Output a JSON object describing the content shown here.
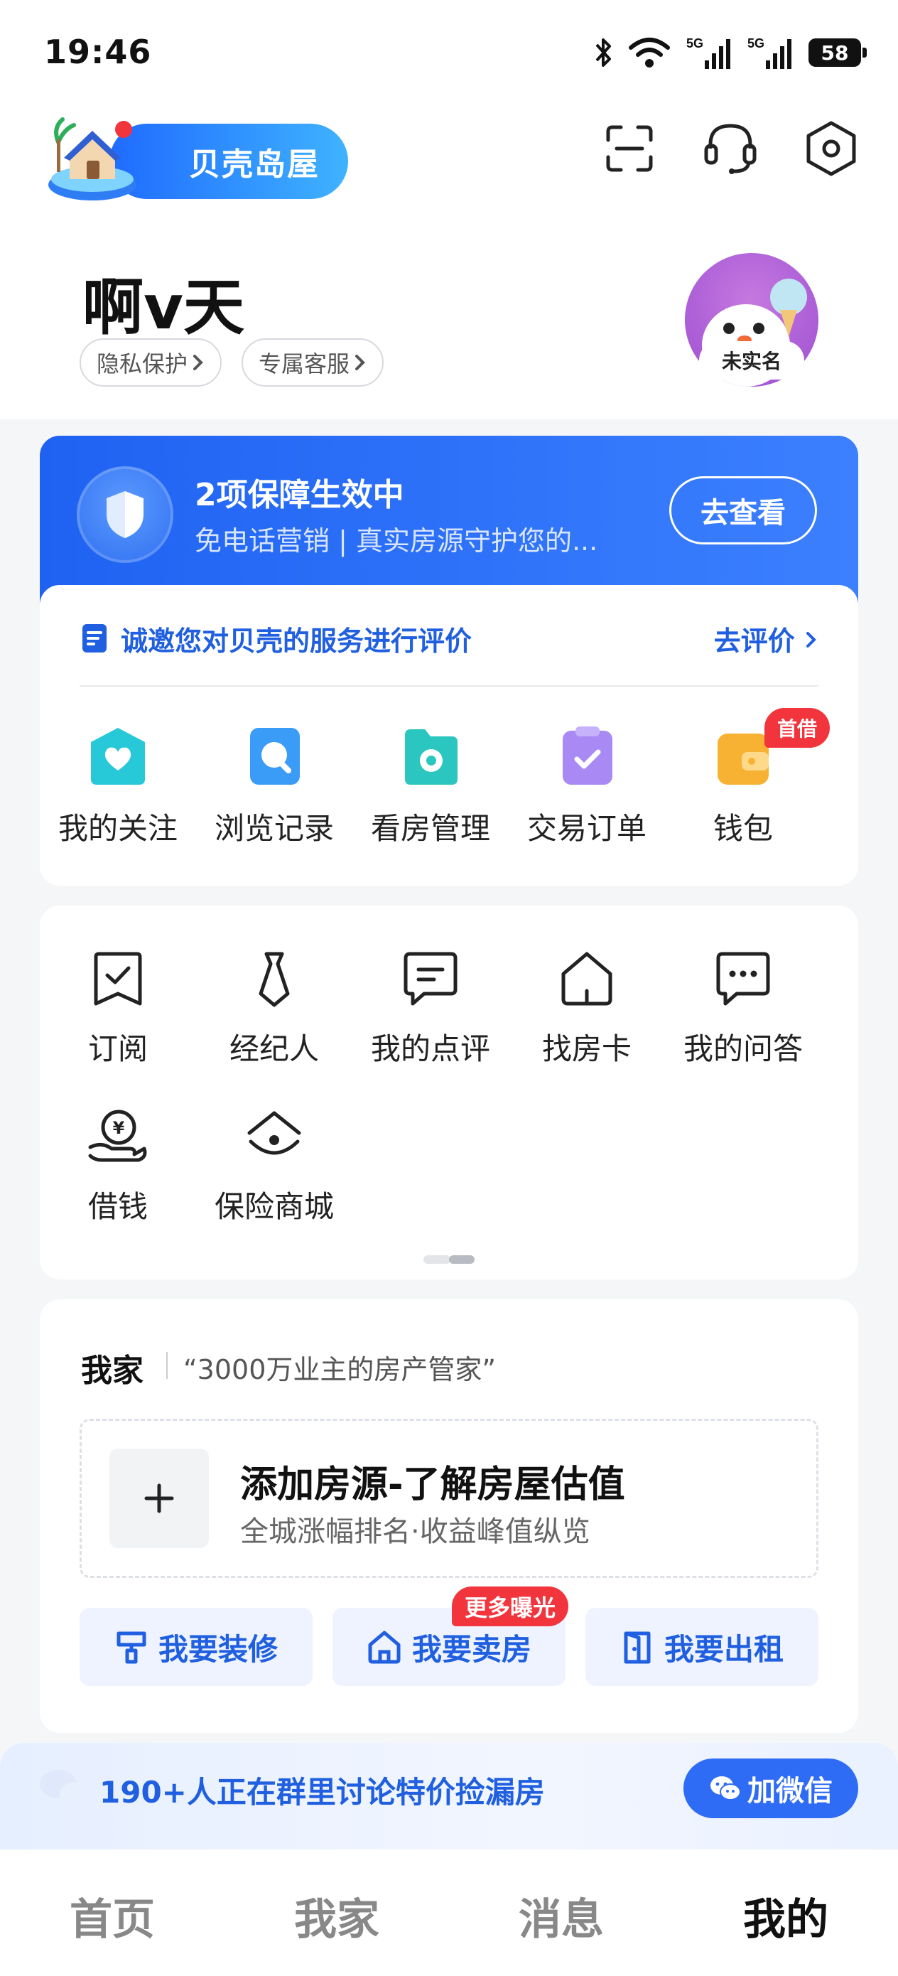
{
  "status_bar": {
    "time": "19:46",
    "battery": "58"
  },
  "app": {
    "logo_text": "贝壳岛屋"
  },
  "profile": {
    "name": "啊v天",
    "chips": [
      "隐私保护",
      "专属客服"
    ],
    "avatar_badge": "未实名"
  },
  "protection": {
    "title": "2项保障生效中",
    "subtitle": "免电话营销 | 真实房源守护您的...",
    "button": "去查看"
  },
  "review": {
    "text": "诚邀您对贝壳的服务进行评价",
    "link": "去评价"
  },
  "quick_services": [
    {
      "label": "我的关注",
      "icon": "heart-icon",
      "color": "#27c8d8"
    },
    {
      "label": "浏览记录",
      "icon": "search-icon",
      "color": "#3a9cf6"
    },
    {
      "label": "看房管理",
      "icon": "folder-icon",
      "color": "#2cc6c0"
    },
    {
      "label": "交易订单",
      "icon": "clipboard-icon",
      "color": "#a98af5"
    },
    {
      "label": "钱包",
      "icon": "wallet-icon",
      "color": "#f7b233"
    }
  ],
  "wallet_badge": "首借",
  "tools": [
    {
      "label": "订阅",
      "icon": "subscribe-icon"
    },
    {
      "label": "经纪人",
      "icon": "agent-tie-icon"
    },
    {
      "label": "我的点评",
      "icon": "comment-icon"
    },
    {
      "label": "找房卡",
      "icon": "house-card-icon"
    },
    {
      "label": "我的问答",
      "icon": "qa-icon"
    },
    {
      "label": "借钱",
      "icon": "loan-icon"
    },
    {
      "label": "保险商城",
      "icon": "insurance-icon"
    }
  ],
  "my_home": {
    "title": "我家",
    "slogan": "“3000万业主的房产管家”",
    "add_title": "添加房源-了解房屋估值",
    "add_subtitle": "全城涨幅排名·收益峰值纵览",
    "actions": [
      "我要装修",
      "我要卖房",
      "我要出租"
    ],
    "sell_badge": "更多曝光"
  },
  "group_banner": {
    "text": "190+人正在群里讨论特价捡漏房",
    "button": "加微信"
  },
  "tabbar": {
    "tabs": [
      "首页",
      "我家",
      "消息",
      "我的"
    ],
    "active": "我的"
  }
}
